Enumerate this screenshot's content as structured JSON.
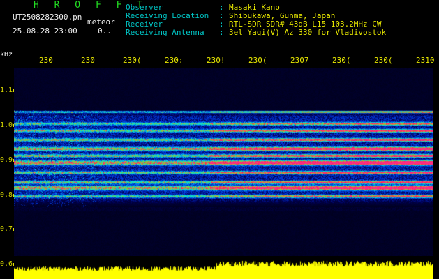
{
  "header": {
    "title": "H R O F F T",
    "filename": "UT2508282300.pn",
    "mode": "meteor",
    "datetime": "25.08.28 23:00",
    "counter": "0..",
    "fields": [
      {
        "label": "Observer",
        "sep": ":",
        "value": "Masaki Kano"
      },
      {
        "label": "Receiving Location",
        "sep": ":",
        "value": "Shibukawa, Gunma, Japan"
      },
      {
        "label": "Receiver",
        "sep": ":",
        "value": "RTL-SDR SDR# 43dB L15 103.2MHz CW"
      },
      {
        "label": "Receiving Antenna",
        "sep": ":",
        "value": "3el Yagi(V) Az 330 for Vladivostok"
      }
    ]
  },
  "axis": {
    "unit": "kHz",
    "y_ticks": [
      "1.1",
      "1.0",
      "0.9",
      "0.8",
      "0.7",
      "0.6"
    ],
    "x_ticks": [
      "230",
      "230",
      "230(",
      "230:",
      "230!",
      "230(",
      "2307",
      "230(",
      "230(",
      "2310"
    ]
  },
  "colors": {
    "background": "#000000",
    "header_label": "#00c8c8",
    "header_value": "#e8e800",
    "title": "#22dd22",
    "trace": "#ffff00"
  }
}
